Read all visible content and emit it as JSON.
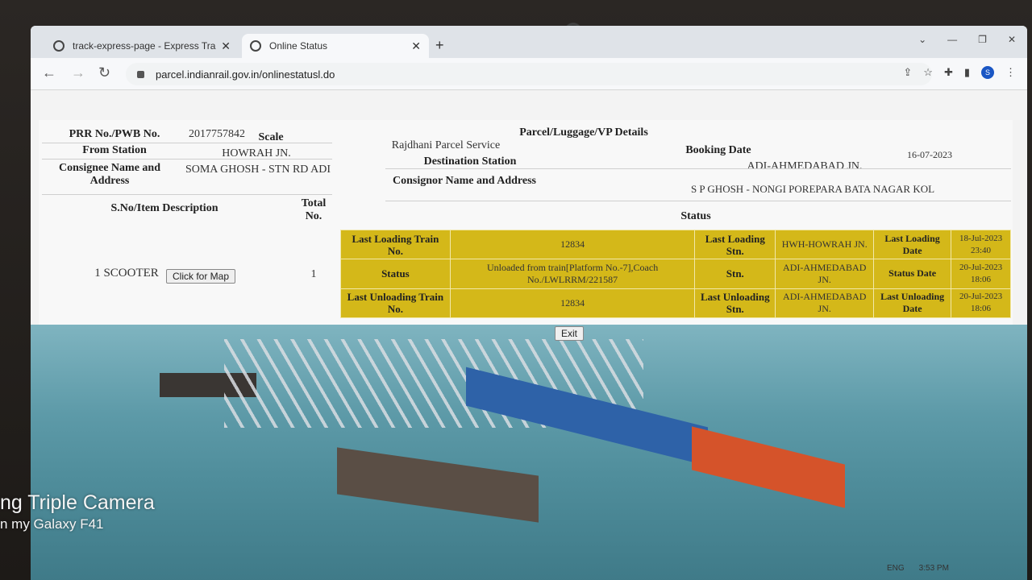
{
  "browser": {
    "tabs": [
      {
        "label": "track-express-page - Express Tra"
      },
      {
        "label": "Online Status"
      }
    ],
    "new_tab": "+",
    "url": "parcel.indianrail.gov.in/onlinestatusl.do",
    "avatar": "S",
    "window_controls": [
      "⌄",
      "—",
      "❐",
      "✕"
    ]
  },
  "details": {
    "heading": "Parcel/Luggage/VP Details",
    "prr_label": "PRR No./PWB No.",
    "prr_value": "2017757842",
    "scale_label": "Scale",
    "service_value": "Rajdhani Parcel Service",
    "booking_date_label": "Booking Date",
    "booking_date_value": "16-07-2023",
    "from_station_label": "From Station",
    "from_station_value": "HOWRAH JN.",
    "destination_label": "Destination Station",
    "destination_value": "ADI-AHMEDABAD JN.",
    "consignee_label": "Consignee Name and Address",
    "consignee_value": "SOMA GHOSH - STN RD ADI",
    "consignor_label": "Consignor Name and Address",
    "consignor_value": "S P GHOSH - NONGI POREPARA BATA NAGAR KOL",
    "item_desc_label": "S.No/Item Description",
    "total_no_label": "Total No.",
    "status_label": "Status",
    "item_value": "1 SCOOTER",
    "map_button": "Click for Map",
    "total_value": "1"
  },
  "status_grid": {
    "row1": [
      "Last Loading Train No.",
      "12834",
      "Last Loading Stn.",
      "HWH-HOWRAH JN.",
      "Last Loading Date",
      "18-Jul-2023 23:40"
    ],
    "row2": [
      "Status",
      "Unloaded from train[Platform No.-7],Coach No./LWLRRM/221587",
      "Stn.",
      "ADI-AHMEDABAD JN.",
      "Status Date",
      "20-Jul-2023 18:06"
    ],
    "row3": [
      "Last Unloading Train No.",
      "12834",
      "Last Unloading Stn.",
      "ADI-AHMEDABAD JN.",
      "Last Unloading Date",
      "20-Jul-2023 18:06"
    ]
  },
  "exit_button": "Exit",
  "camera_watermark": {
    "line1": "ng Triple Camera",
    "line2": "n my Galaxy F41"
  },
  "taskbar": {
    "lang": "ENG",
    "time": "3:53 PM"
  },
  "colors": {
    "status_grid_bg": "#d4b819",
    "panel_bg": "#f8f8f8",
    "water": "#5d9aa8"
  }
}
